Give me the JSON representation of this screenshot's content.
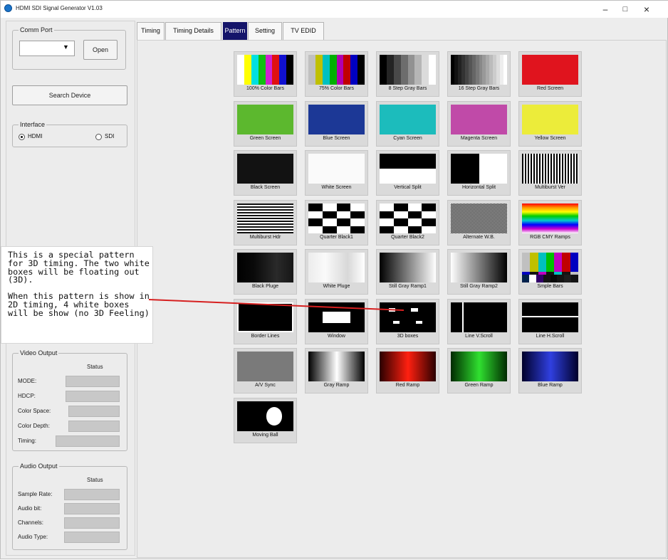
{
  "window": {
    "title": "HDMI SDI Signal Generator V1.03",
    "controls": [
      "–",
      "□",
      "×"
    ]
  },
  "left_panel": {
    "comm_port": {
      "legend": "Comm Port",
      "selected": "",
      "open_label": "Open"
    },
    "search_label": "Search Device",
    "interface": {
      "legend": "Interface",
      "options": [
        "HDMI",
        "SDI"
      ],
      "selected": "HDMI"
    },
    "video_output": {
      "legend": "Video Output",
      "status_header": "Status",
      "rows": [
        {
          "label": "MODE:"
        },
        {
          "label": "HDCP:"
        },
        {
          "label": "Color Space:"
        },
        {
          "label": "Color Depth:"
        },
        {
          "label": "Timing:"
        }
      ]
    },
    "audio_output": {
      "legend": "Audio Output",
      "status_header": "Status",
      "rows": [
        {
          "label": "Sample Rate:"
        },
        {
          "label": "Audio bit:"
        },
        {
          "label": "Channels:"
        },
        {
          "label": "Audio Type:"
        }
      ]
    }
  },
  "tabs": [
    {
      "label": "Timing"
    },
    {
      "label": "Timing Details"
    },
    {
      "label": "Pattern",
      "active": true
    },
    {
      "label": "Setting"
    },
    {
      "label": "TV EDID"
    }
  ],
  "patterns": [
    {
      "label": "100% Color Bars",
      "thumb": "colorbars100"
    },
    {
      "label": "75% Color Bars",
      "thumb": "colorbars75"
    },
    {
      "label": "8 Step Gray Bars",
      "thumb": "gray8"
    },
    {
      "label": "16 Step Gray Bars",
      "thumb": "gray16"
    },
    {
      "label": "Red Screen",
      "thumb": "red"
    },
    {
      "label": "Green Screen",
      "thumb": "green"
    },
    {
      "label": "Blue Screen",
      "thumb": "blue"
    },
    {
      "label": "Cyan Screen",
      "thumb": "cyan"
    },
    {
      "label": "Magenta Screen",
      "thumb": "magenta"
    },
    {
      "label": "Yellow Screen",
      "thumb": "yellow"
    },
    {
      "label": "Black Screen",
      "thumb": "black"
    },
    {
      "label": "White Screen",
      "thumb": "white"
    },
    {
      "label": "Vertical Split",
      "thumb": "vsplit"
    },
    {
      "label": "Horizontal Split",
      "thumb": "hsplit"
    },
    {
      "label": "Multiburst Ver",
      "thumb": "mbver"
    },
    {
      "label": "Multiburst Hdr",
      "thumb": "mbhdr"
    },
    {
      "label": "Quarter Black1",
      "thumb": "qb1"
    },
    {
      "label": "Quarter Black2",
      "thumb": "qb2"
    },
    {
      "label": "Alternate W.B.",
      "thumb": "altwb"
    },
    {
      "label": "RGB CMY Ramps",
      "thumb": "rgbcmy"
    },
    {
      "label": "Black Pluge",
      "thumb": "bpluge"
    },
    {
      "label": "White Pluge",
      "thumb": "wpluge"
    },
    {
      "label": "Still Gray Ramp1",
      "thumb": "sgr1"
    },
    {
      "label": "Still Gray Ramp2",
      "thumb": "sgr2"
    },
    {
      "label": "Smple Bars",
      "thumb": "smpte"
    },
    {
      "label": "Border Lines",
      "thumb": "border"
    },
    {
      "label": "Window",
      "thumb": "window"
    },
    {
      "label": "3D boxes",
      "thumb": "boxes3d"
    },
    {
      "label": "Line V.Scroll",
      "thumb": "linev"
    },
    {
      "label": "Line H.Scroll",
      "thumb": "lineh"
    },
    {
      "label": "A/V Sync",
      "thumb": "avsync"
    },
    {
      "label": "Gray Ramp",
      "thumb": "grayramp"
    },
    {
      "label": "Red Ramp",
      "thumb": "redramp"
    },
    {
      "label": "Green Ramp",
      "thumb": "greenramp"
    },
    {
      "label": "Blue Ramp",
      "thumb": "blueramp"
    },
    {
      "label": "Moving Ball",
      "thumb": "ball"
    }
  ],
  "annotation": {
    "paragraph1": "This is a special pattern for 3D timing. The two white boxes will be floating out (3D).",
    "paragraph2": "When this pattern is show in 2D timing, 4 white boxes will be show (no 3D Feeling)",
    "arrow_color": "#d62020"
  },
  "colors": {
    "active_tab": "#15156a",
    "logo": "#1a73c9"
  }
}
